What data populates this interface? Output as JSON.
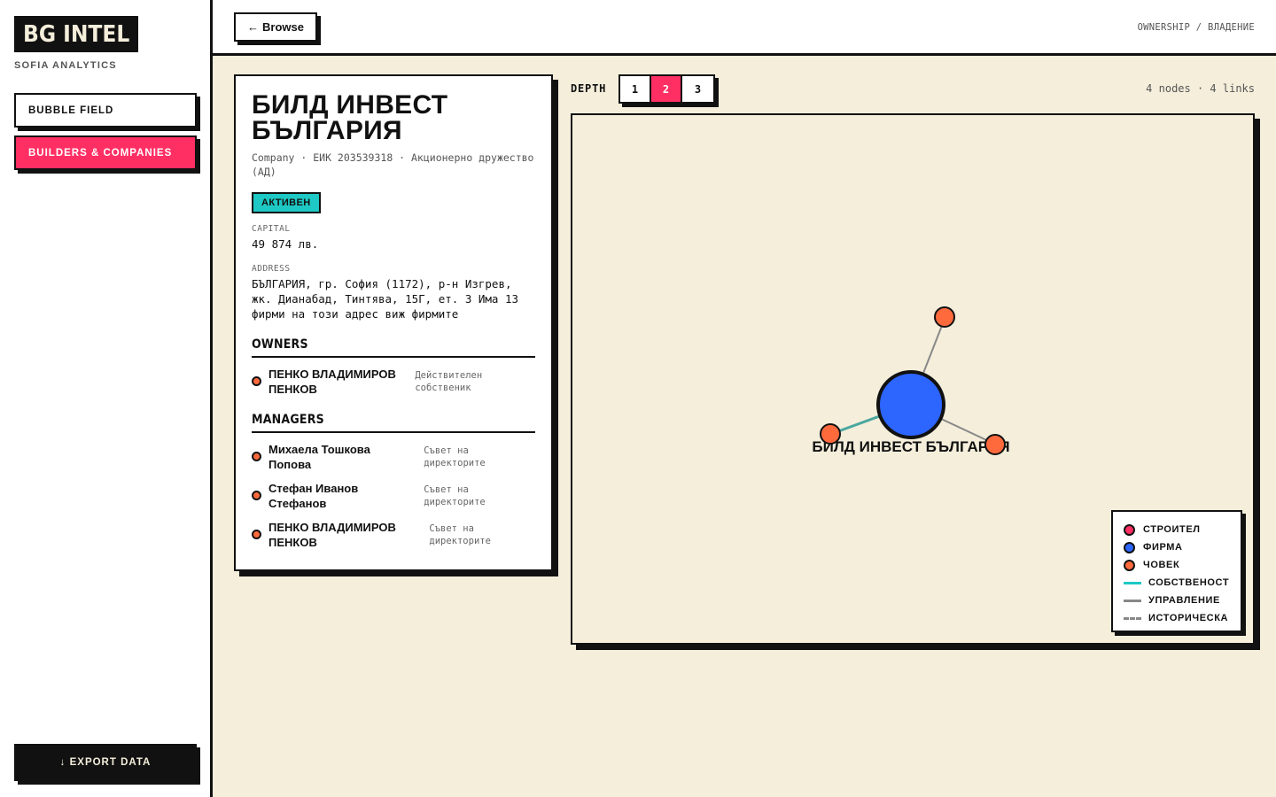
{
  "app": {
    "logo": "BG INTEL",
    "subtitle": "SOFIA ANALYTICS"
  },
  "sidebar": {
    "items": [
      {
        "label": "BUBBLE FIELD",
        "active": false
      },
      {
        "label": "BUILDERS & COMPANIES",
        "active": true
      }
    ],
    "export_label": "↓ EXPORT DATA"
  },
  "header": {
    "browse_label": "Browse",
    "breadcrumb": "OWNERSHIP / ВЛАДЕНИЕ"
  },
  "company": {
    "name": "БИЛД ИНВЕСТ БЪЛГАРИЯ",
    "meta": "Company · ЕИК 203539318 · Акционерно дружество (АД)",
    "status": "АКТИВЕН",
    "capital_label": "CAPITAL",
    "capital": "49 874 лв.",
    "address_label": "ADDRESS",
    "address": "БЪЛГАРИЯ, гр. София (1172), р-н Изгрев, жк. Дианабад, Тинтява, 15Г, ет. 3 Има 13 фирми на този адрес виж фирмите",
    "owners_title": "OWNERS",
    "owners": [
      {
        "name": "ПЕНКО ВЛАДИМИРОВ ПЕНКОВ",
        "role": "Действителен собственик"
      }
    ],
    "managers_title": "MANAGERS",
    "managers": [
      {
        "name": "Михаела Тошкова Попова",
        "role": "Съвет на директорите"
      },
      {
        "name": "Стефан Иванов Стефанов",
        "role": "Съвет на директорите"
      },
      {
        "name": "ПЕНКО ВЛАДИМИРОВ ПЕНКОВ",
        "role": "Съвет на директорите"
      }
    ]
  },
  "graph": {
    "depth_label": "DEPTH",
    "depth_options": [
      "1",
      "2",
      "3"
    ],
    "depth_selected": "2",
    "stats": "4 nodes · 4 links",
    "center_label": "БИЛД ИНВЕСТ БЪЛГАРИЯ",
    "colors": {
      "builder": "#ff2f64",
      "company": "#2d65ff",
      "person": "#ff6a3d",
      "ownership": "#1ec8c4",
      "management": "#888888"
    },
    "legend": [
      {
        "label": "СТРОИТЕЛ",
        "kind": "dot",
        "color": "#ff2f64"
      },
      {
        "label": "ФИРМА",
        "kind": "dot",
        "color": "#2d65ff"
      },
      {
        "label": "ЧОВЕК",
        "kind": "dot",
        "color": "#ff6a3d"
      },
      {
        "label": "СОБСТВЕНОСТ",
        "kind": "line",
        "color": "#1ec8c4"
      },
      {
        "label": "УПРАВЛЕНИЕ",
        "kind": "line",
        "color": "#888888"
      },
      {
        "label": "ИСТОРИЧЕСКА",
        "kind": "dashed",
        "color": "#888888"
      }
    ]
  }
}
